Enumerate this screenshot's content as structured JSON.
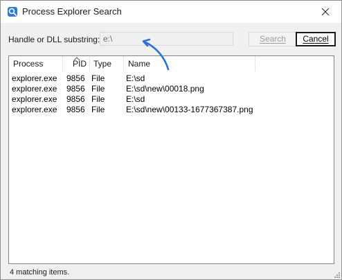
{
  "window": {
    "title": "Process Explorer Search",
    "app_icon": "process-explorer-icon",
    "close_icon": "close-icon"
  },
  "search": {
    "label": "Handle or DLL substring:",
    "value": "e:\\",
    "search_button": "Search",
    "cancel_button": "Cancel"
  },
  "results": {
    "columns": [
      "Process",
      "PID",
      "Type",
      "Name"
    ],
    "sorted_column": "PID",
    "rows": [
      {
        "process": "explorer.exe",
        "pid": "9856",
        "type": "File",
        "name": "E:\\sd"
      },
      {
        "process": "explorer.exe",
        "pid": "9856",
        "type": "File",
        "name": "E:\\sd\\new\\00018.png"
      },
      {
        "process": "explorer.exe",
        "pid": "9856",
        "type": "File",
        "name": "E:\\sd"
      },
      {
        "process": "explorer.exe",
        "pid": "9856",
        "type": "File",
        "name": "E:\\sd\\new\\00133-1677367387.png"
      }
    ]
  },
  "status": {
    "text": "4 matching items."
  },
  "colors": {
    "annotation_arrow": "#2f6fd6",
    "window_background": "#f0f0f0",
    "list_background": "#ffffff"
  }
}
